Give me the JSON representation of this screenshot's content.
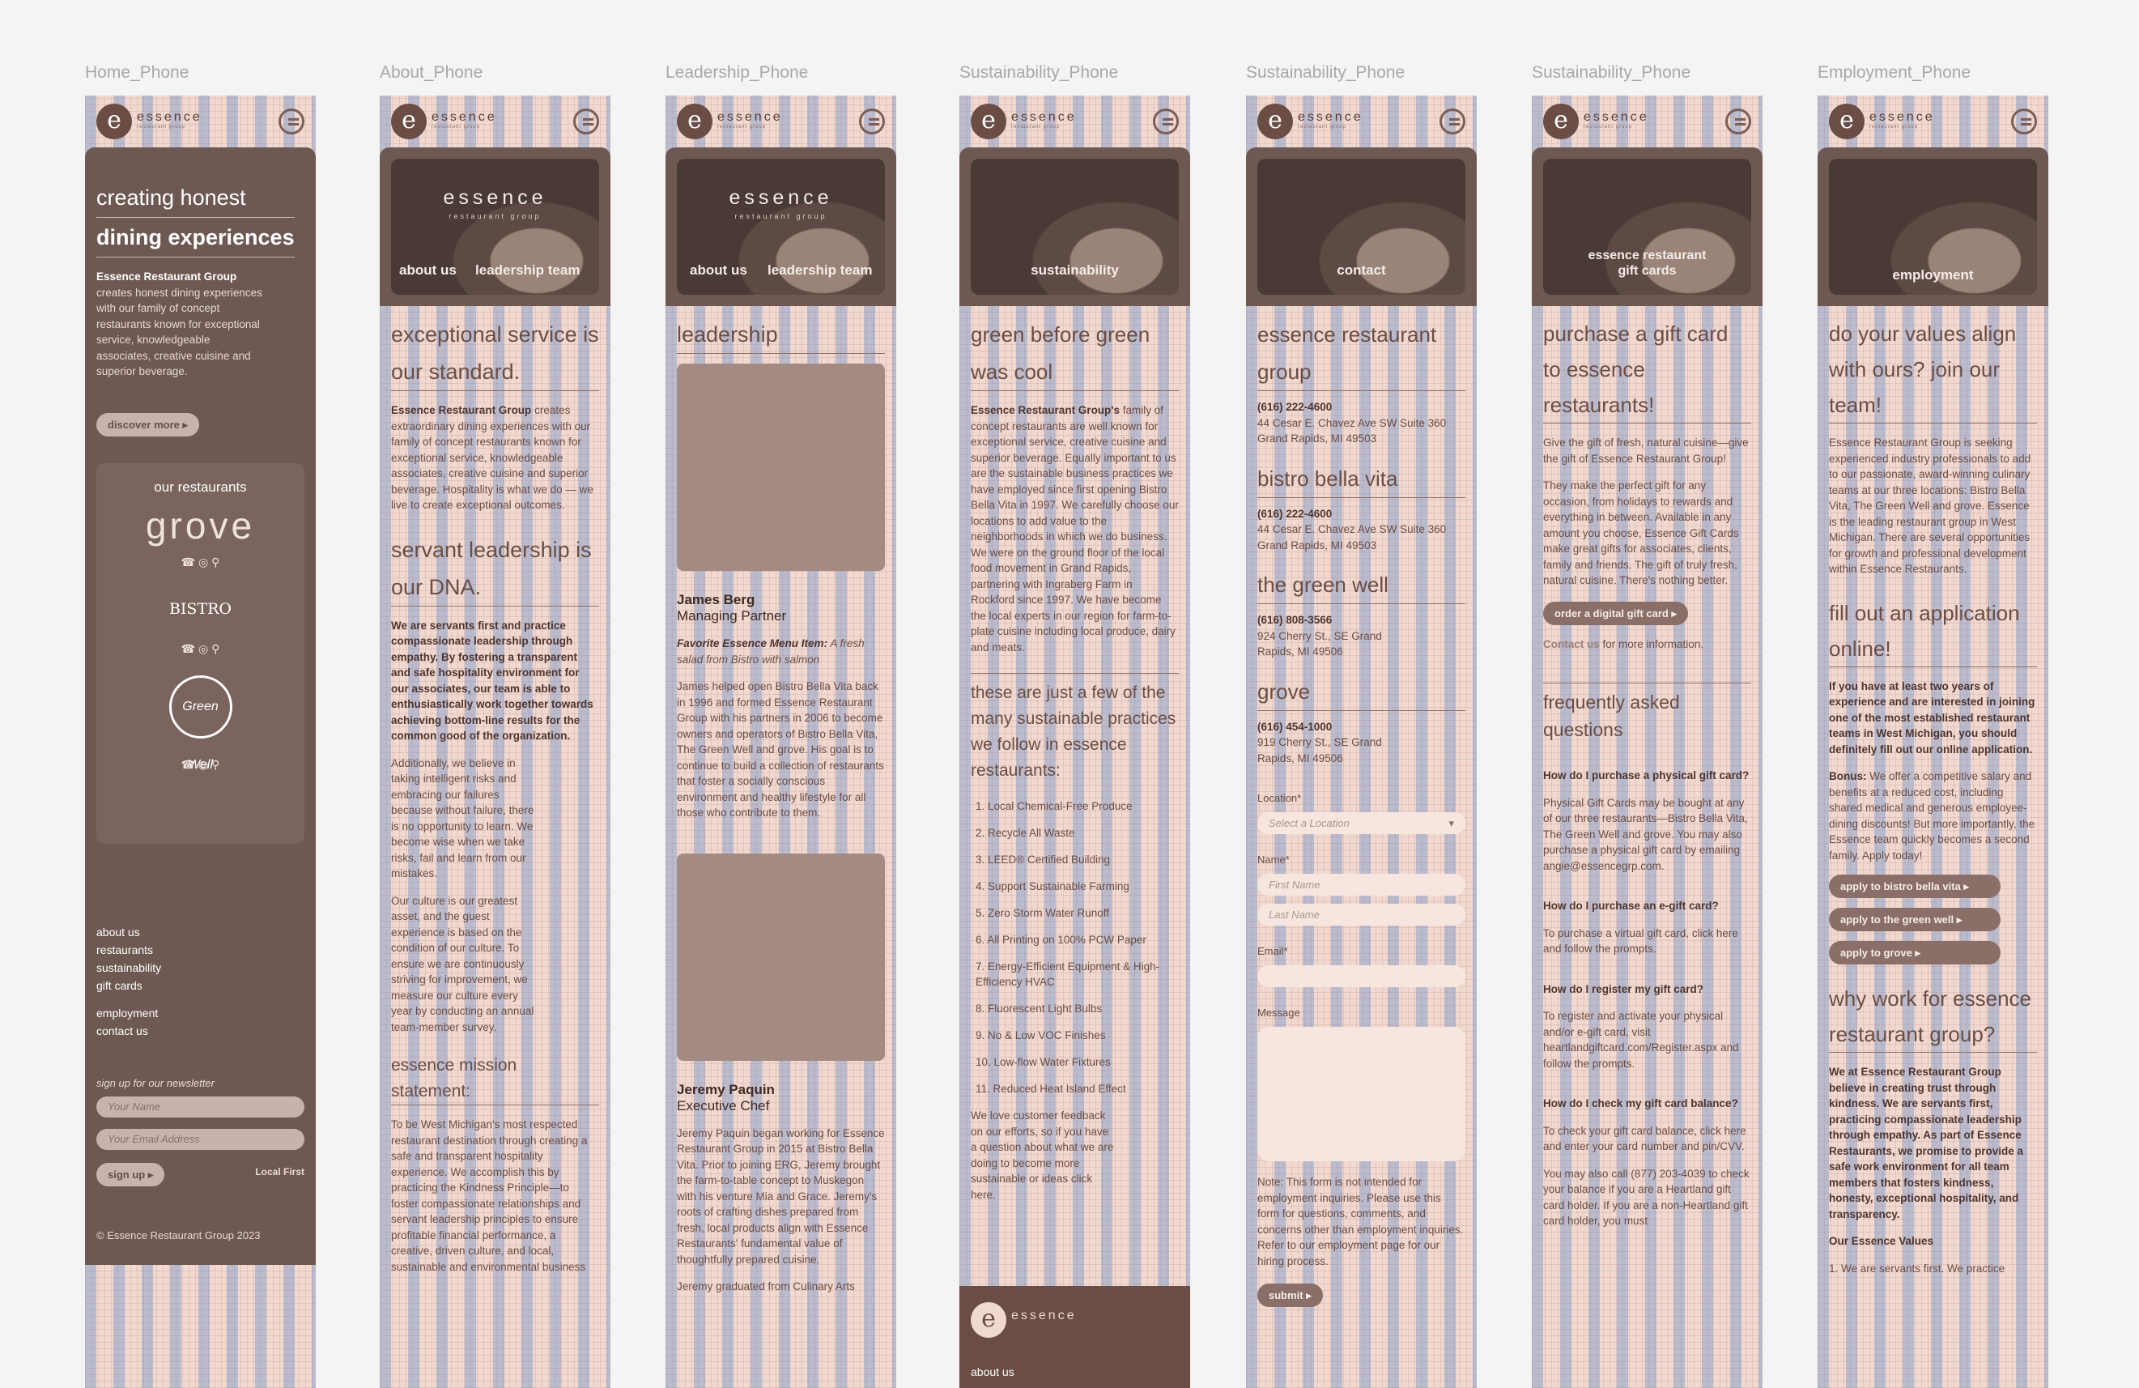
{
  "frames": [
    "Home_Phone",
    "About_Phone",
    "Leadership_Phone",
    "Sustainability_Phone",
    "Sustainability_Phone",
    "Sustainability_Phone",
    "Employment_Phone"
  ],
  "logo": {
    "mark": "e",
    "name": "essence",
    "sub": "restaurant group"
  },
  "home": {
    "headline_1": "creating honest",
    "headline_2": "dining experiences",
    "intro_bold": "Essence Restaurant Group",
    "intro": "creates honest dining experiences with our family of concept restaurants known for exceptional service, knowledgeable associates, creative cuisine and superior beverage.",
    "cta": "discover more",
    "our_restaurants": "our restaurants",
    "grove": "grove",
    "bistro": "BISTRO",
    "green_well": "Green Well",
    "footer_links": [
      "about us",
      "restaurants",
      "sustainability",
      "gift cards",
      "employment",
      "contact us"
    ],
    "newsletter": "sign up for our newsletter",
    "ph_name": "Your Name",
    "ph_email": "Your Email Address",
    "sign_up": "sign up",
    "local_first": "Local First",
    "copyright": "© Essence Restaurant Group 2023"
  },
  "about": {
    "hero_title": "essence",
    "hero_sub": "restaurant group",
    "nav_about": "about us",
    "nav_leadership": "leadership team",
    "h_service": "exceptional service is our standard.",
    "p1_bold": "Essence Restaurant Group",
    "p1": "creates extraordinary dining experiences with our family of concept restaurants known for exceptional service, knowledgeable associates, creative cuisine and superior beverage. Hospitality is what we do — we live to create exceptional outcomes.",
    "h_servant": "servant leadership is our DNA.",
    "p2_bold": "We are servants first and practice compassionate leadership through empathy. By fostering a transparent and safe hospitality environment for our associates, our team is able to enthusiastically work together towards achieving bottom-line results for the common good of the organization.",
    "p3": "Additionally, we believe in taking intelligent risks and embracing our failures because without failure, there is no opportunity to learn. We become wise when we take risks, fail and learn from our mistakes.",
    "p4": "Our culture is our greatest asset, and the guest experience is based on the condition of our culture. To ensure we are continuously striving for improvement, we measure our culture every year by conducting an annual team-member survey.",
    "h_mission": "essence mission statement:",
    "p5": "To be West Michigan's most respected restaurant destination through creating a safe and transparent hospitality experience. We accomplish this by practicing the Kindness Principle—to foster compassionate relationships and servant leadership principles to ensure profitable financial performance, a creative, driven culture, and local, sustainable and environmental business"
  },
  "leadership": {
    "title": "leadership",
    "p1_name": "James Berg",
    "p1_role": "Managing Partner",
    "p1_fav_label": "Favorite Essence Menu Item:",
    "p1_fav": "A fresh salad from Bistro with salmon",
    "p1_bio": "James helped open Bistro Bella Vita back in 1996 and formed Essence Restaurant Group with his partners in 2006 to become owners and operators of Bistro Bella Vita, The Green Well and grove. His goal is to continue to build a collection of restaurants that foster a socially conscious environment and healthy lifestyle for all those who contribute to them.",
    "p2_name": "Jeremy Paquin",
    "p2_role": "Executive Chef",
    "p2_bio": "Jeremy Paquin began working for Essence Restaurant Group in 2015 at Bistro Bella Vita. Prior to joining ERG, Jeremy brought the farm-to-table concept to Muskegon with his venture Mia and Grace. Jeremy's roots of crafting dishes prepared from fresh, local products align with Essence Restaurants' fundamental value of thoughtfully prepared cuisine.",
    "p2_more": "Jeremy graduated from Culinary Arts"
  },
  "sustain": {
    "hero": "sustainability",
    "title": "green before green was cool",
    "p1_bold": "Essence Restaurant Group's",
    "p1": "family of concept restaurants are well known for exceptional service, creative cuisine and superior beverage. Equally important to us are the sustainable business practices we have employed since first opening Bistro Bella Vita in 1997. We carefully choose our locations to add value to the neighborhoods in which we do business. We were on the ground floor of the local food movement in Grand Rapids, partnering with Ingraberg Farm in Rockford since 1997. We have become the local experts in our region for farm-to-plate cuisine including local produce, dairy and meats.",
    "h2": "these are just a few of the many sustainable practices we follow in essence restaurants:",
    "list": [
      "1. Local Chemical-Free Produce",
      "2. Recycle All Waste",
      "3. LEED® Certified Building",
      "4. Support Sustainable Farming",
      "5. Zero Storm Water Runoff",
      "6. All Printing on 100% PCW Paper",
      "7. Energy-Efficient Equipment & High-Efficiency HVAC",
      "8. Fluorescent Light Bulbs",
      "9. No & Low VOC Finishes",
      "10. Low-flow Water Fixtures",
      "11. Reduced Heat Island Effect"
    ],
    "p2": "We love customer feedback on our efforts, so if you have a question about what we are doing to become more sustainable or ideas click here.",
    "footer_name": "essence",
    "footer_link": "about us"
  },
  "contact": {
    "hero": "contact",
    "loc1": "essence restaurant group",
    "loc1_phone": "(616) 222-4600",
    "loc1_addr": "44 Cesar E. Chavez Ave SW Suite 360 Grand Rapids, MI 49503",
    "loc2": "bistro bella vita",
    "loc2_phone": "(616) 222-4600",
    "loc2_addr": "44 Cesar E. Chavez Ave SW Suite 360 Grand Rapids, MI 49503",
    "loc3": "the green well",
    "loc3_phone": "(616) 808-3566",
    "loc3_addr": "924 Cherry St., SE Grand Rapids, MI 49506",
    "loc4": "grove",
    "loc4_phone": "(616) 454-1000",
    "loc4_addr": "919 Cherry St., SE Grand Rapids, MI 49506",
    "location_label": "Location*",
    "location_ph": "Select a Location",
    "name_label": "Name*",
    "first_ph": "First Name",
    "last_ph": "Last Name",
    "email_label": "Email*",
    "message_label": "Message",
    "note": "Note: This form is not intended for employment inquiries. Please use this form for questions, comments, and concerns other than employment inquiries. Refer to our employment page for our hiring process.",
    "submit": "submit"
  },
  "gift": {
    "hero": "essence restaurant gift cards",
    "title": "purchase a gift card to essence restaurants!",
    "p1": "Give the gift of fresh, natural cuisine—give the gift of Essence Restaurant Group!",
    "p2": "They make the perfect gift for any occasion, from holidays to rewards and everything in between. Available in any amount you choose, Essence Gift Cards make great gifts for associates, clients, family and friends. The gift of truly fresh, natural cuisine. There's nothing better.",
    "order": "order a digital gift card",
    "contact_link": "Contact us",
    "contact_rest": "for more information.",
    "faq_title": "frequently asked questions",
    "q1": "How do I purchase a physical gift card?",
    "a1": "Physical Gift Cards may be bought at any of our three restaurants—Bistro Bella Vita, The Green Well and grove. You may also purchase a physical gift card by emailing angie@essencegrp.com.",
    "q2": "How do I purchase an e-gift card?",
    "a2": "To purchase a virtual gift card, click here and follow the prompts.",
    "q3": "How do I register my gift card?",
    "a3": "To register and activate your physical and/or e-gift card, visit heartlandgiftcard.com/Register.aspx and follow the prompts.",
    "q4": "How do I check my gift card balance?",
    "a4": "To check your gift card balance, click here and enter your card number and pin/CVV.",
    "a5": "You may also call (877) 203-4039 to check your balance if you are a Heartland gift card holder. If you are a non-Heartland gift card holder, you must"
  },
  "employ": {
    "hero": "employment",
    "title": "do your values align with ours? join our team!",
    "p1": "Essence Restaurant Group is seeking experienced industry professionals to add to our passionate, award-winning culinary teams at our three locations: Bistro Bella Vita, The Green Well and grove. Essence is the leading restaurant group in West Michigan. There are several opportunities for growth and professional development within Essence Restaurants.",
    "h2": "fill out an application online!",
    "p2_bold": "If you have at least two years of experience and are interested in joining one of the most established restaurant teams in West Michigan, you should definitely fill out our online application.",
    "bonus_label": "Bonus:",
    "bonus": "We offer a competitive salary and benefits at a reduced cost, including shared medical and generous employee-dining discounts! But more importantly, the Essence team quickly becomes a second family. Apply today!",
    "apply1": "apply to bistro bella vita",
    "apply2": "apply to the green well",
    "apply3": "apply to grove",
    "h3": "why work for essence restaurant group?",
    "p3_bold": "We at Essence Restaurant Group believe in creating trust through kindness. We are servants first, practicing compassionate leadership through empathy. As part of Essence Restaurants, we promise to provide a safe work environment for all team members that fosters kindness, honesty, exceptional hospitality, and transparency.",
    "core": "Our Essence Values",
    "core1": "1. We are servants first. We practice"
  }
}
